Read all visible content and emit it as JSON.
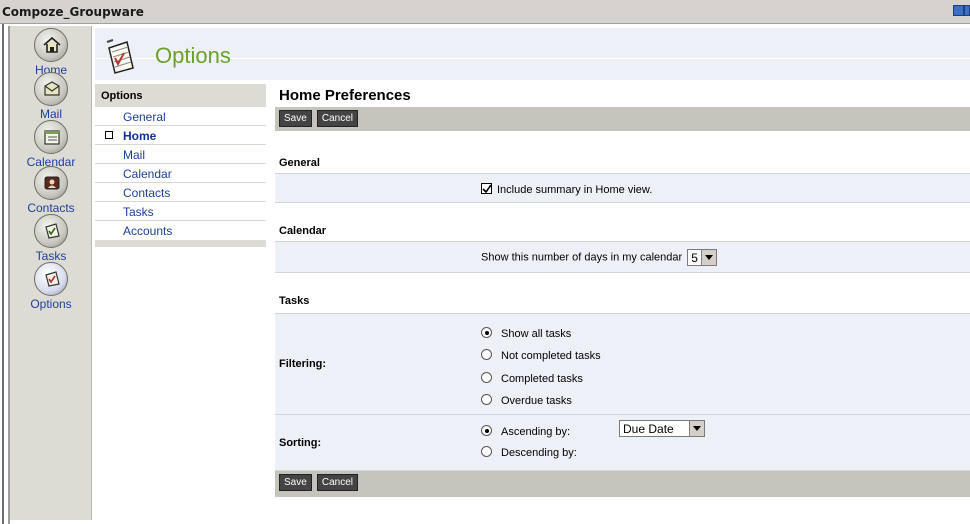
{
  "window": {
    "title": "Compoze_Groupware"
  },
  "modules": [
    {
      "label": "Home",
      "icon": "home-icon"
    },
    {
      "label": "Mail",
      "icon": "mail-icon"
    },
    {
      "label": "Calendar",
      "icon": "calendar-icon"
    },
    {
      "label": "Contacts",
      "icon": "contacts-icon"
    },
    {
      "label": "Tasks",
      "icon": "tasks-icon"
    },
    {
      "label": "Options",
      "icon": "options-icon"
    }
  ],
  "header": {
    "title": "Options"
  },
  "optnav": {
    "heading": "Options",
    "items": [
      "General",
      "Home",
      "Mail",
      "Calendar",
      "Contacts",
      "Tasks",
      "Accounts"
    ],
    "active": "Home"
  },
  "content": {
    "title": "Home Preferences",
    "save_label": "Save",
    "cancel_label": "Cancel",
    "general": {
      "heading": "General",
      "summary_label": "Include summary in Home view.",
      "summary_checked": true
    },
    "calendar": {
      "heading": "Calendar",
      "days_label": "Show this number of days in my calendar",
      "days_value": "5"
    },
    "tasks": {
      "heading": "Tasks",
      "filtering_label": "Filtering:",
      "filter_options": [
        "Show all tasks",
        "Not completed tasks",
        "Completed tasks",
        "Overdue tasks"
      ],
      "filter_selected": "Show all tasks",
      "sorting_label": "Sorting:",
      "sort_ascending_label": "Ascending by:",
      "sort_descending_label": "Descending by:",
      "sort_selected": "Ascending by:",
      "sort_field": "Due Date"
    }
  },
  "colors": {
    "module_label": "#1d3e9c",
    "header_title": "#6aa12a",
    "toolbar_bg": "#c4c4bc",
    "row_bg": "#eef0f8"
  }
}
